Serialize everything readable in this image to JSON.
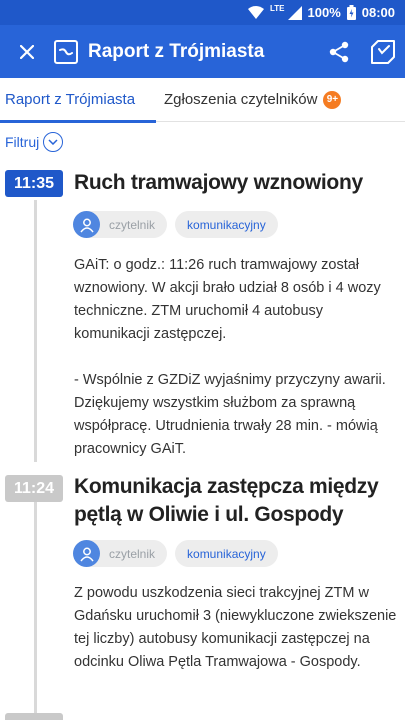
{
  "status_bar": {
    "network": "LTE",
    "battery": "100%",
    "time": "08:00"
  },
  "app_bar": {
    "title": "Raport z Trójmiasta",
    "icons": [
      "close-icon",
      "logo-icon",
      "share-icon",
      "bookmark-icon"
    ]
  },
  "tabs": [
    {
      "label": "Raport z Trójmiasta",
      "active": true
    },
    {
      "label": "Zgłoszenia czytelników",
      "badge": "9+"
    }
  ],
  "filter": {
    "label": "Filtruj"
  },
  "posts": [
    {
      "time": "11:35",
      "title": "Ruch tramwajowy wznowiony",
      "author": "czytelnik",
      "category": "komunikacyjny",
      "body": "GAiT: o godz.: 11:26 ruch tramwajowy został wznowiony. W akcji brało udział 8 osób i 4 wozy techniczne. ZTM uruchomił 4 autobusy komunikacji zastępczej.\n\n- Wspólnie z GZDiZ wyjaśnimy przyczyny awarii. Dziękujemy wszystkim służbom za sprawną współpracę. Utrudnienia trwały 28 min. - mówią pracownicy GAiT."
    },
    {
      "time": "11:24",
      "title": "Komunikacja zastępcza między pętlą w Oliwie i ul. Gospody",
      "author": "czytelnik",
      "category": "komunikacyjny",
      "body": "Z powodu uszkodzenia sieci trakcyjnej ZTM w Gdańsku uruchomił 3 (niewykluczone zwiekszenie tej liczby) autobusy komunikacji zastępczej na odcinku Oliwa Pętla Tramwajowa - Gospody."
    }
  ],
  "colors": {
    "primary": "#2864d8",
    "status_bar": "#1f58c9",
    "badge": "#f57c22",
    "time_active": "#1f58c9",
    "time_inactive": "#c9c9c9"
  }
}
